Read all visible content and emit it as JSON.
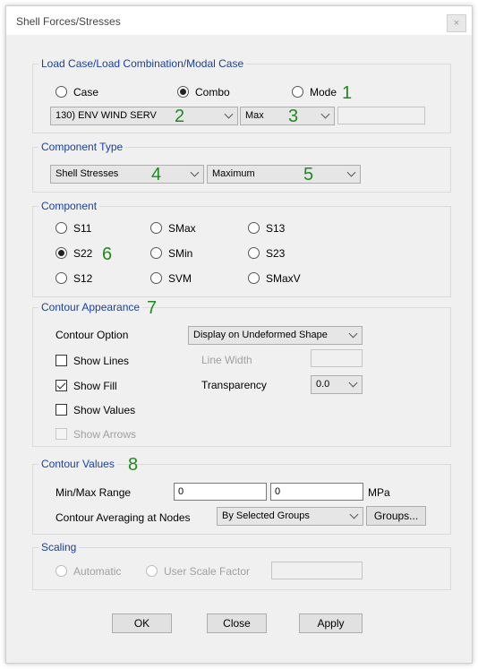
{
  "window": {
    "title": "Shell Forces/Stresses",
    "close_glyph": "×"
  },
  "load_case": {
    "title": "Load Case/Load Combination/Modal Case",
    "radios": {
      "case": "Case",
      "combo": "Combo",
      "mode": "Mode"
    },
    "selected": "combo",
    "case_value": "130) ENV WIND SERV",
    "step_value": "Max",
    "mode_value": ""
  },
  "component_type": {
    "title": "Component Type",
    "type_value": "Shell Stresses",
    "sub_value": "Maximum"
  },
  "component": {
    "title": "Component",
    "options": [
      "S11",
      "SMax",
      "S13",
      "S22",
      "SMin",
      "S23",
      "S12",
      "SVM",
      "SMaxV"
    ],
    "selected": "S22"
  },
  "contour_appearance": {
    "title": "Contour Appearance",
    "option_label": "Contour Option",
    "option_value": "Display on Undeformed Shape",
    "show_lines": "Show Lines",
    "show_fill": "Show Fill",
    "show_values": "Show Values",
    "show_arrows": "Show Arrows",
    "line_width_label": "Line Width",
    "line_width_value": "",
    "transparency_label": "Transparency",
    "transparency_value": "0.0",
    "checked": {
      "show_lines": false,
      "show_fill": true,
      "show_values": false,
      "show_arrows": false
    }
  },
  "contour_values": {
    "title": "Contour Values",
    "range_label": "Min/Max Range",
    "min_value": "0",
    "max_value": "0",
    "unit": "MPa",
    "averaging_label": "Contour Averaging at Nodes",
    "averaging_value": "By Selected Groups",
    "groups_button": "Groups..."
  },
  "scaling": {
    "title": "Scaling",
    "automatic": "Automatic",
    "user_scale": "User Scale Factor",
    "scale_value": ""
  },
  "buttons": {
    "ok": "OK",
    "close": "Close",
    "apply": "Apply"
  },
  "annotations": [
    "1",
    "2",
    "3",
    "4",
    "5",
    "6",
    "7",
    "8"
  ],
  "colors": {
    "group_title": "#1a3fa0",
    "annotation": "#1e8a1e",
    "window_bg": "#f0f0f0"
  }
}
